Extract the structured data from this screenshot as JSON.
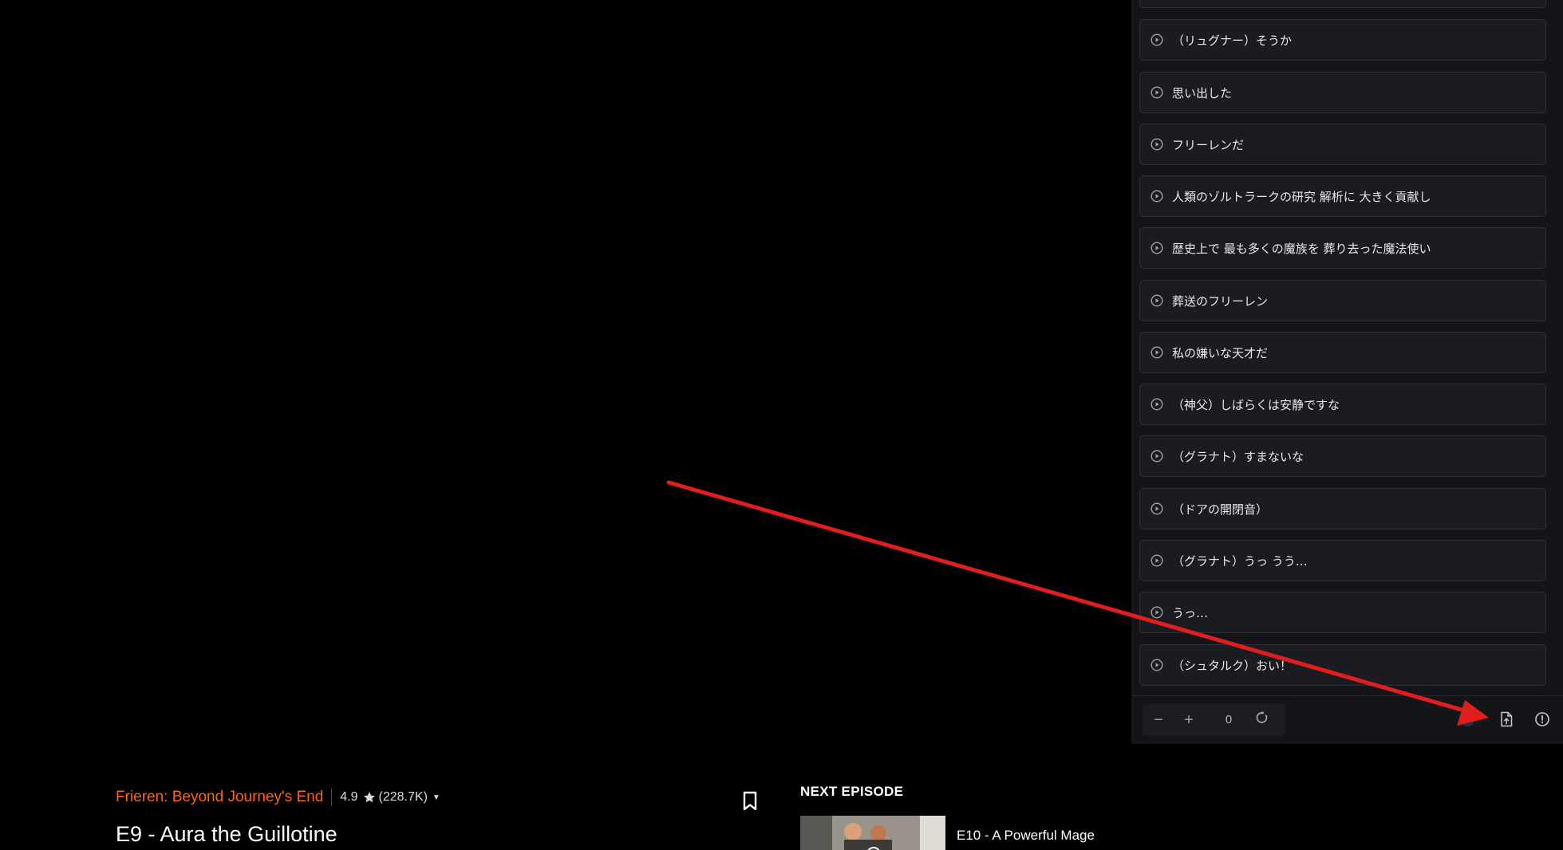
{
  "subtitles": [
    {
      "text": ""
    },
    {
      "text": "（リュグナー）そうか"
    },
    {
      "text": "思い出した"
    },
    {
      "text": "フリーレンだ"
    },
    {
      "text": "人類のゾルトラークの研究 解析に 大きく貢献し"
    },
    {
      "text": "歴史上で 最も多くの魔族を 葬り去った魔法使い"
    },
    {
      "text": "葬送のフリーレン"
    },
    {
      "text": "私の嫌いな天才だ"
    },
    {
      "text": "（神父）しばらくは安静ですな"
    },
    {
      "text": "（グラナト）すまないな"
    },
    {
      "text": "（ドアの開閉音）"
    },
    {
      "text": "（グラナト）うっ うう…"
    },
    {
      "text": "うっ…"
    },
    {
      "text": "（シュタルク）おい！"
    }
  ],
  "toolbar": {
    "minus_label": "−",
    "plus_label": "+",
    "offset_value": "0",
    "icons": [
      "minus-icon",
      "plus-icon",
      "reset-icon",
      "translate-icon",
      "export-file-icon",
      "info-icon"
    ]
  },
  "series": {
    "title": "Frieren: Beyond Journey's End",
    "rating": "4.9",
    "rating_count": "(228.7K)"
  },
  "episode": {
    "title": "E9 - Aura the Guillotine"
  },
  "next_episode": {
    "label": "NEXT EPISODE",
    "title": "E10 - A Powerful Mage"
  },
  "colors": {
    "accent": "#ff640a",
    "annotation_arrow": "#e01e1e",
    "panel_bg": "#141519",
    "item_bg": "#1b1c21"
  }
}
